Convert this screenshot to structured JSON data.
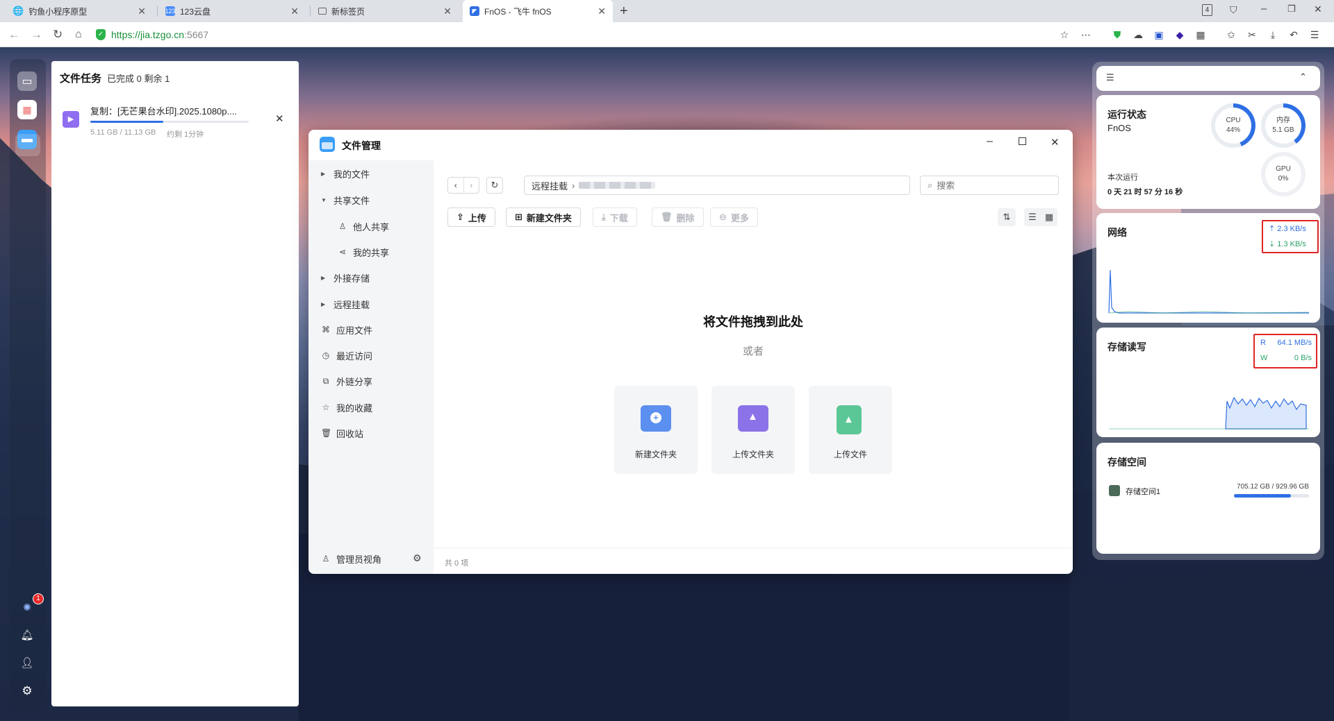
{
  "browser": {
    "tabs": [
      {
        "label": "钓鱼小程序原型",
        "icon": "globe-icon"
      },
      {
        "label": "123云盘",
        "icon": "123-icon"
      },
      {
        "label": "新标签页",
        "icon": "page-icon"
      },
      {
        "label": "FnOS - 飞牛 fnOS",
        "icon": "fnos-icon",
        "active": true
      }
    ],
    "url_scheme_host": "https://jia.tzgo.cn",
    "url_port": ":5667",
    "tab_count": "4"
  },
  "dock": {
    "notification_count": "1"
  },
  "task_panel": {
    "title": "文件任务",
    "summary": "已完成 0 剩余 1",
    "task": {
      "name": "复制：[无芒果台水印].2025.1080p....",
      "progress_text": "5.11 GB / 11.13 GB",
      "eta": "约剩 1分钟",
      "progress": 0.46
    }
  },
  "file_manager": {
    "title": "文件管理",
    "sidebar": [
      {
        "label": "我的文件",
        "kind": "tree-collapsed"
      },
      {
        "label": "共享文件",
        "kind": "tree-expanded"
      },
      {
        "label": "他人共享",
        "kind": "child",
        "icon": "users-icon"
      },
      {
        "label": "我的共享",
        "kind": "child",
        "icon": "share-icon"
      },
      {
        "label": "外接存储",
        "kind": "tree-collapsed"
      },
      {
        "label": "远程挂载",
        "kind": "tree-collapsed"
      },
      {
        "label": "应用文件",
        "kind": "icon",
        "icon": "apps-icon"
      },
      {
        "label": "最近访问",
        "kind": "icon",
        "icon": "clock-icon"
      },
      {
        "label": "外链分享",
        "kind": "icon",
        "icon": "external-link-icon"
      },
      {
        "label": "我的收藏",
        "kind": "icon",
        "icon": "star-icon"
      },
      {
        "label": "回收站",
        "kind": "icon",
        "icon": "trash-icon"
      }
    ],
    "admin_view": "管理员视角",
    "breadcrumb_root": "远程挂载",
    "search_placeholder": "搜索",
    "toolbar": {
      "upload": "上传",
      "new_folder": "新建文件夹",
      "download": "下载",
      "delete": "删除",
      "more": "更多"
    },
    "drop_title": "将文件拖拽到此处",
    "drop_or": "或者",
    "cards": [
      {
        "label": "新建文件夹",
        "color": "#5b8ff0"
      },
      {
        "label": "上传文件夹",
        "color": "#8b72e8"
      },
      {
        "label": "上传文件",
        "color": "#5cc796"
      }
    ],
    "item_count": "共 0 项"
  },
  "widgets": {
    "status": {
      "title": "运行状态",
      "host": "FnOS",
      "cpu_label": "CPU",
      "cpu_value": "44%",
      "cpu_pct": 44,
      "mem_label": "内存",
      "mem_value": "5.1 GB",
      "mem_pct": 40,
      "gpu_label": "GPU",
      "gpu_value": "0%",
      "uptime_label": "本次运行",
      "uptime": "0 天 21 时 57 分 16 秒"
    },
    "network": {
      "title": "网络",
      "up": "2.3 KB/s",
      "down": "1.3 KB/s"
    },
    "storage_io": {
      "title": "存储读写",
      "read_label": "R",
      "read": "64.1 MB/s",
      "write_label": "W",
      "write": "0 B/s"
    },
    "storage_space": {
      "title": "存储空间",
      "volume": "存储空间1",
      "usage": "705.12 GB / 929.96 GB",
      "used_fraction": 0.758
    }
  }
}
